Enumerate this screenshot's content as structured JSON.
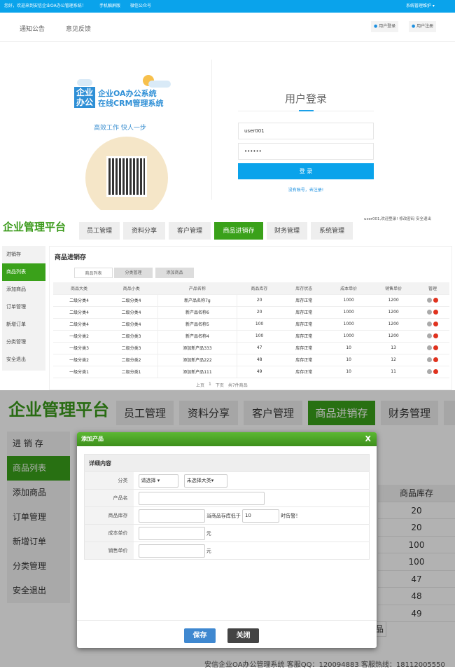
{
  "login_page": {
    "topbar": {
      "welcome": "您好，欢迎来到安信企业OA办公管理系统！",
      "mobile": "手机触屏版",
      "wechat": "微信公众号",
      "admin": "系统管理维护 ▾"
    },
    "nav": {
      "notice": "通知公告",
      "feedback": "意见反馈",
      "login": "用户登录",
      "register": "用户注册"
    },
    "logo": {
      "mark": "企业办公",
      "line1": "企业OA办公系统",
      "line2": "在线CRM管理系统"
    },
    "slogan": "高效工作 快人一步",
    "form": {
      "title": "用户登录",
      "username": "user001",
      "password": "••••••",
      "submit": "登 录",
      "register_link": "没有账号，去注册!"
    }
  },
  "platform": {
    "logo": "企业管理平台",
    "tabs": [
      "员工管理",
      "资料分享",
      "客户管理",
      "商品进销存",
      "财务管理",
      "系统管理"
    ],
    "user_info": "user001,欢迎登录!  修改密码  安全退出",
    "sidebar": [
      "进销存",
      "商品列表",
      "添加商品",
      "订单管理",
      "新增订单",
      "分类管理",
      "安全退出"
    ],
    "page_title": "商品进销存",
    "subtabs": [
      "商品列表",
      "分类管理",
      "添加商品"
    ],
    "table": {
      "headers": [
        "商品大类",
        "商品小类",
        "产品名称",
        "商品库存",
        "库存状态",
        "成本单价",
        "销售单价",
        "管理"
      ],
      "rows": [
        [
          "二级分类4",
          "二级分类4",
          "新产品名称7g",
          "20",
          "库存正常",
          "1000",
          "1200"
        ],
        [
          "二级分类4",
          "二级分类4",
          "新产品名称6",
          "20",
          "库存正常",
          "1000",
          "1200"
        ],
        [
          "二级分类4",
          "二级分类4",
          "新产品名称5",
          "100",
          "库存正常",
          "1000",
          "1200"
        ],
        [
          "一级分类2",
          "二级分类3",
          "新产品名称4",
          "100",
          "库存正常",
          "1000",
          "1200"
        ],
        [
          "一级分类3",
          "二级分类3",
          "添加新产品333",
          "47",
          "库存正常",
          "10",
          "13"
        ],
        [
          "一级分类2",
          "二级分类2",
          "添加新产品222",
          "48",
          "库存正常",
          "10",
          "12"
        ],
        [
          "一级分类1",
          "二级分类1",
          "添加新产品111",
          "49",
          "库存正常",
          "10",
          "11"
        ]
      ]
    },
    "pagination": {
      "prev": "上页",
      "current": "1",
      "next": "下页",
      "total": "共7件商品"
    }
  },
  "dialog_view": {
    "logo": "企业管理平台",
    "tabs": [
      "员工管理",
      "资料分享",
      "客户管理",
      "商品进销存",
      "财务管理"
    ],
    "sidebar": [
      "进 销 存",
      "商品列表",
      "添加商品",
      "订单管理",
      "新增订单",
      "分类管理",
      "安全退出"
    ],
    "column_header": "商品库存",
    "column_values": [
      "20",
      "20",
      "100",
      "100",
      "47",
      "48",
      "49"
    ],
    "behind_button": "品",
    "footer": "安信企业OA办公管理系统 客服QQ：120094883 客服热线：18112005550",
    "modal": {
      "title": "添加产品",
      "close": "X",
      "section": "详细内容",
      "category_label": "分类",
      "category_main": "请选择",
      "category_sub": "未选择大类",
      "name_label": "产品名",
      "stock_label": "商品库存",
      "stock_warn_prefix": "当商品存库低于",
      "stock_warn_value": "10",
      "stock_warn_suffix": "时告警！",
      "cost_label": "成本单价",
      "price_label": "销售单价",
      "unit": "元",
      "save": "保存",
      "cancel": "关闭"
    }
  }
}
